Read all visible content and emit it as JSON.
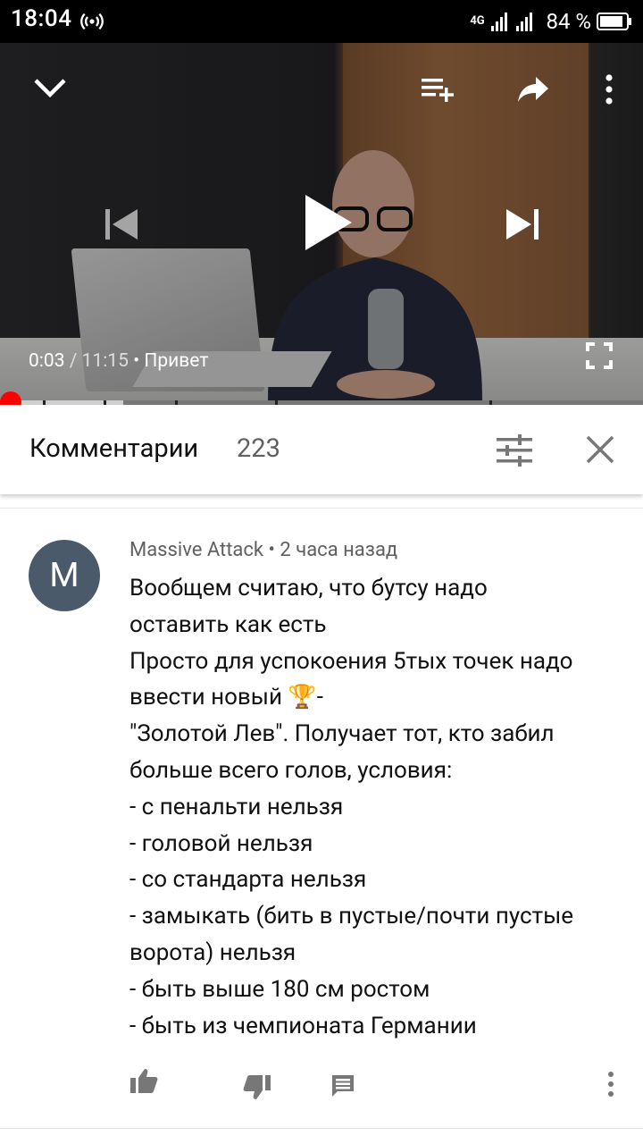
{
  "status_bar": {
    "time": "18:04",
    "network": "4G",
    "battery_percent": "84 %"
  },
  "player": {
    "current_time": "0:03",
    "separator": " / ",
    "duration": "11:15",
    "bullet": " • ",
    "title": "Привет",
    "progress_fraction": 0.004
  },
  "comments": {
    "title": "Комментарии",
    "count": "223"
  },
  "comment": {
    "avatar_letter": "M",
    "author": "Massive Attack",
    "bullet": " • ",
    "time": "2 часа назад",
    "lines": [
      "Вообщем считаю, что бутсу надо",
      "оставить как есть",
      "Просто для успокоения  5тых точек надо",
      "ввести новый 🏆-",
      "\"Золотой Лев\". Получает тот, кто забил",
      "больше всего голов, условия:",
      "- с пенальти нельзя",
      "- головой нельзя",
      "- со стандарта нельзя",
      "- замыкать (бить в пустые/почти пустые",
      "ворота) нельзя",
      "- быть выше 180 см ростом",
      "- быть из чемпионата Германии"
    ]
  },
  "icons": {
    "collapse": "chevron-down-icon",
    "add_to_playlist": "playlist-add-icon",
    "share": "share-icon",
    "more": "more-vertical-icon",
    "previous": "skip-previous-icon",
    "play": "play-icon",
    "next": "skip-next-icon",
    "fullscreen": "fullscreen-icon",
    "sort": "tune-icon",
    "close": "close-icon",
    "like": "thumb-up-icon",
    "dislike": "thumb-down-icon",
    "reply": "comment-icon",
    "comment_more": "more-vertical-icon"
  },
  "colors": {
    "progress_played": "#ff0000",
    "status_bar_bg": "#000000",
    "avatar_bg": "#4a5a6a"
  }
}
